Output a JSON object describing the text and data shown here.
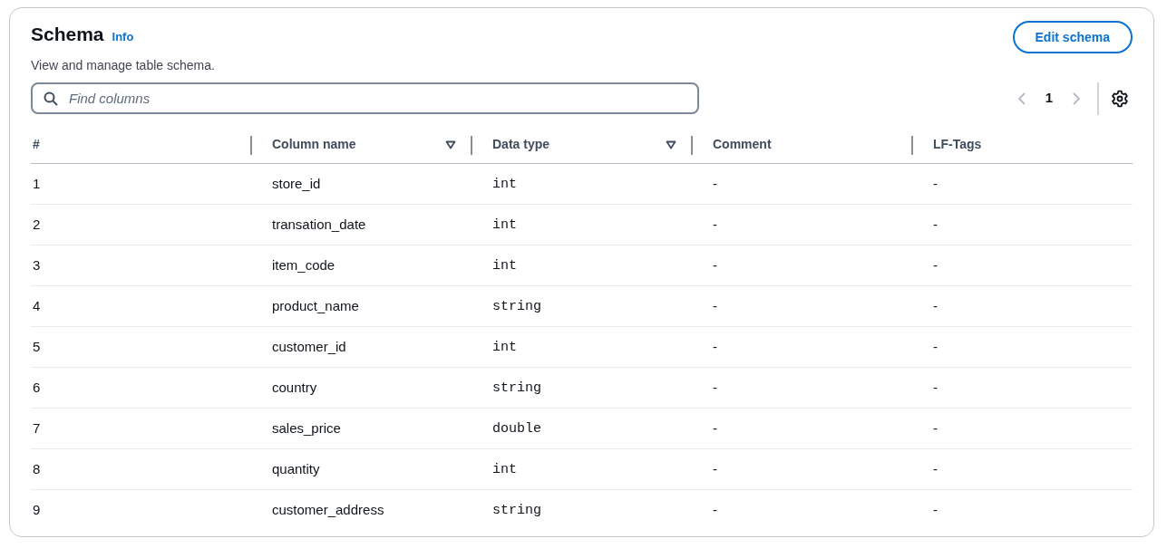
{
  "header": {
    "title": "Schema",
    "info_link": "Info",
    "description": "View and manage table schema.",
    "edit_button": "Edit schema"
  },
  "search": {
    "placeholder": "Find columns"
  },
  "pagination": {
    "pages": [
      {
        "label": "1",
        "selected": true
      }
    ],
    "previous_disabled": true,
    "next_disabled": true
  },
  "table": {
    "columns": [
      {
        "label": "#",
        "sortable": false
      },
      {
        "label": "Column name",
        "sortable": true
      },
      {
        "label": "Data type",
        "sortable": true
      },
      {
        "label": "Comment",
        "sortable": false
      },
      {
        "label": "LF-Tags",
        "sortable": false
      }
    ],
    "rows": [
      [
        "1",
        "store_id",
        "int",
        "-",
        "-"
      ],
      [
        "2",
        "transation_date",
        "int",
        "-",
        "-"
      ],
      [
        "3",
        "item_code",
        "int",
        "-",
        "-"
      ],
      [
        "4",
        "product_name",
        "string",
        "-",
        "-"
      ],
      [
        "5",
        "customer_id",
        "int",
        "-",
        "-"
      ],
      [
        "6",
        "country",
        "string",
        "-",
        "-"
      ],
      [
        "7",
        "sales_price",
        "double",
        "-",
        "-"
      ],
      [
        "8",
        "quantity",
        "int",
        "-",
        "-"
      ],
      [
        "9",
        "customer_address",
        "string",
        "-",
        "-"
      ]
    ]
  }
}
